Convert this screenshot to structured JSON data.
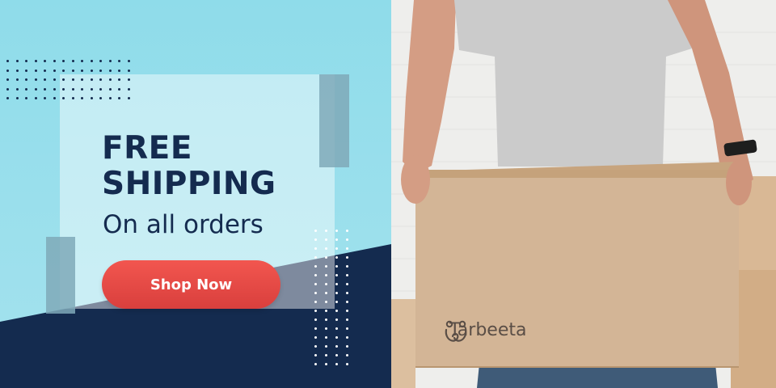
{
  "promo": {
    "headline_line1": "FREE",
    "headline_line2": "SHIPPING",
    "subline": "On all orders",
    "cta_label": "Shop Now"
  },
  "photo": {
    "brand_name": "Tarbeeta",
    "brand_icon": "two-figures-logo-icon"
  },
  "colors": {
    "background_light": "#8fdcea",
    "navy": "#142b4f",
    "accent_red": "#e94a46",
    "box_cardboard": "#d3b596"
  }
}
